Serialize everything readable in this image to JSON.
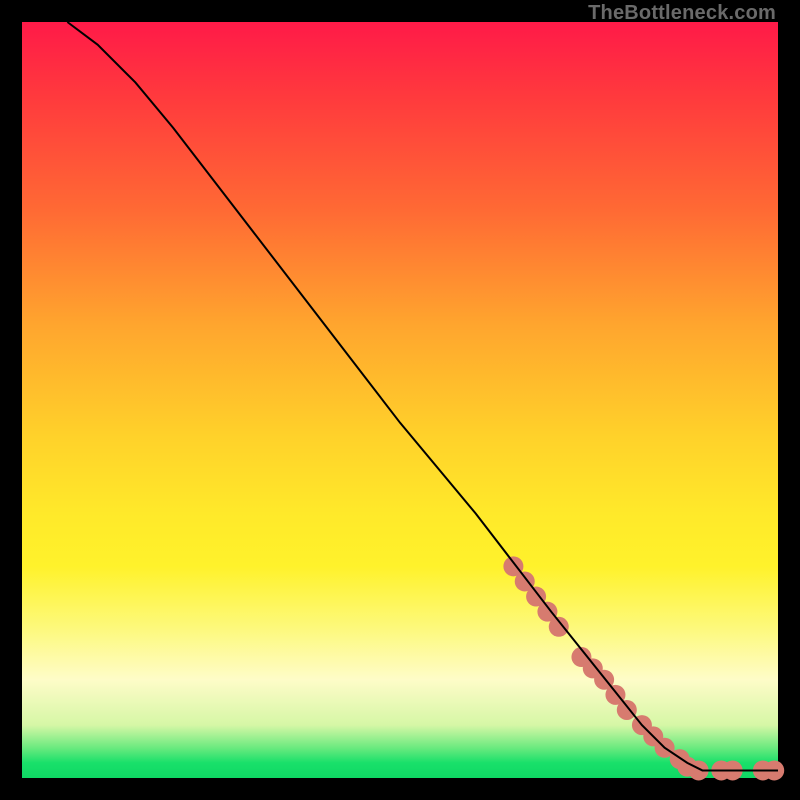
{
  "watermark": "TheBottleneck.com",
  "chart_data": {
    "type": "line",
    "title": "",
    "xlabel": "",
    "ylabel": "",
    "xlim": [
      0,
      100
    ],
    "ylim": [
      0,
      100
    ],
    "grid": false,
    "legend": false,
    "series": [
      {
        "name": "curve",
        "x": [
          6,
          10,
          15,
          20,
          30,
          40,
          50,
          60,
          70,
          78,
          82,
          85,
          88,
          90,
          95,
          100
        ],
        "y": [
          100,
          97,
          92,
          86,
          73,
          60,
          47,
          35,
          22,
          12,
          7,
          4,
          2,
          1,
          1,
          1
        ],
        "stroke": "#000000",
        "stroke_width": 2
      }
    ],
    "markers": [
      {
        "name": "dots",
        "color": "#d77b6f",
        "radius": 10,
        "points": [
          {
            "x": 65,
            "y": 28
          },
          {
            "x": 66.5,
            "y": 26
          },
          {
            "x": 68,
            "y": 24
          },
          {
            "x": 69.5,
            "y": 22
          },
          {
            "x": 71,
            "y": 20
          },
          {
            "x": 74,
            "y": 16
          },
          {
            "x": 75.5,
            "y": 14.5
          },
          {
            "x": 77,
            "y": 13
          },
          {
            "x": 78.5,
            "y": 11
          },
          {
            "x": 80,
            "y": 9
          },
          {
            "x": 82,
            "y": 7
          },
          {
            "x": 83.5,
            "y": 5.5
          },
          {
            "x": 85,
            "y": 4
          },
          {
            "x": 87,
            "y": 2.5
          },
          {
            "x": 88,
            "y": 1.5
          },
          {
            "x": 89.5,
            "y": 1
          },
          {
            "x": 92.5,
            "y": 1
          },
          {
            "x": 94,
            "y": 1
          },
          {
            "x": 98,
            "y": 1
          },
          {
            "x": 99.5,
            "y": 1
          }
        ]
      }
    ]
  }
}
